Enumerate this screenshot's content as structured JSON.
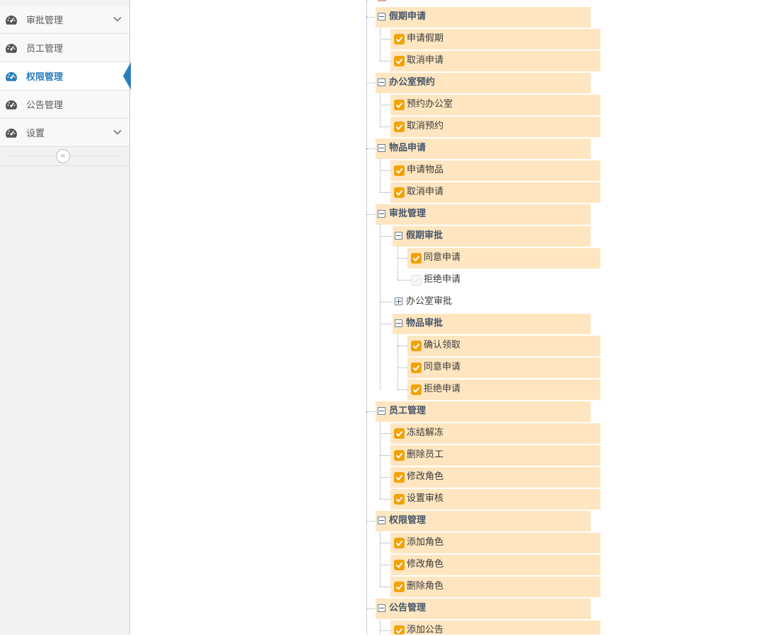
{
  "sidebar": {
    "items": [
      {
        "label": "审批管理",
        "icon": "dashboard-icon",
        "has_submenu": true,
        "active": false
      },
      {
        "label": "员工管理",
        "icon": "dashboard-icon",
        "has_submenu": false,
        "active": false
      },
      {
        "label": "权限管理",
        "icon": "dashboard-icon",
        "has_submenu": false,
        "active": true
      },
      {
        "label": "公告管理",
        "icon": "dashboard-icon",
        "has_submenu": false,
        "active": false
      },
      {
        "label": "设置",
        "icon": "dashboard-icon",
        "has_submenu": true,
        "active": false
      }
    ],
    "collapse_icon": "«"
  },
  "colors": {
    "accent": "#2b7dbc",
    "checkbox": "#f0a30a",
    "highlight": "#ffe6c0"
  },
  "tree": {
    "leave": {
      "label": "假期申请",
      "expanded": true,
      "children": [
        {
          "label": "申请假期",
          "checked": true
        },
        {
          "label": "取消申请",
          "checked": true
        }
      ]
    },
    "office": {
      "label": "办公室预约",
      "expanded": true,
      "children": [
        {
          "label": "预约办公室",
          "checked": true
        },
        {
          "label": "取消预约",
          "checked": true
        }
      ]
    },
    "goods": {
      "label": "物品申请",
      "expanded": true,
      "children": [
        {
          "label": "申请物品",
          "checked": true
        },
        {
          "label": "取消申请",
          "checked": true
        }
      ]
    },
    "approval": {
      "label": "审批管理",
      "expanded": true,
      "leave": {
        "label": "假期审批",
        "expanded": true,
        "children": [
          {
            "label": "同意申请",
            "checked": true
          },
          {
            "label": "拒绝申请",
            "checked": false
          }
        ]
      },
      "office": {
        "label": "办公室审批",
        "expanded": false
      },
      "goods": {
        "label": "物品审批",
        "expanded": true,
        "children": [
          {
            "label": "确认领取",
            "checked": true
          },
          {
            "label": "同意申请",
            "checked": true
          },
          {
            "label": "拒绝申请",
            "checked": true
          }
        ]
      }
    },
    "staff": {
      "label": "员工管理",
      "expanded": true,
      "children": [
        {
          "label": "冻结解冻",
          "checked": true
        },
        {
          "label": "删除员工",
          "checked": true
        },
        {
          "label": "修改角色",
          "checked": true
        },
        {
          "label": "设置审核",
          "checked": true
        }
      ]
    },
    "perm": {
      "label": "权限管理",
      "expanded": true,
      "children": [
        {
          "label": "添加角色",
          "checked": true
        },
        {
          "label": "修改角色",
          "checked": true
        },
        {
          "label": "删除角色",
          "checked": true
        }
      ]
    },
    "notice": {
      "label": "公告管理",
      "expanded": true,
      "children": [
        {
          "label": "添加公告",
          "checked": true
        }
      ]
    }
  }
}
